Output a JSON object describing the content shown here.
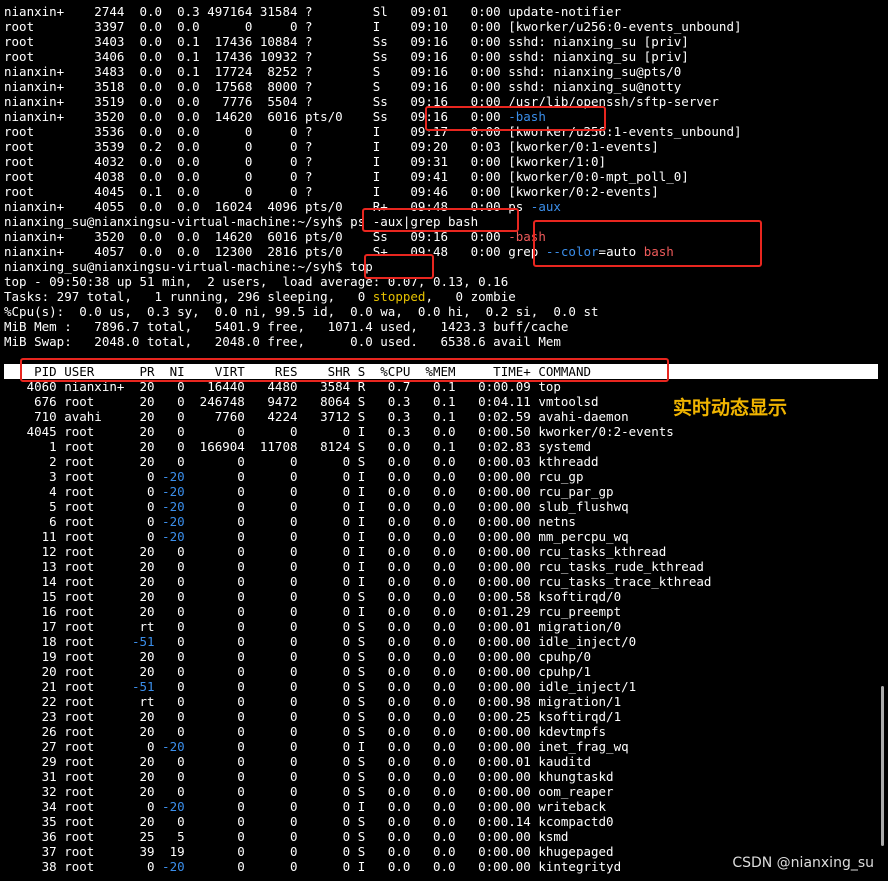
{
  "terminal": {
    "lines": [
      [
        {
          "t": "nianxin+    2744  0.0  0.3 497164 31584 ?        Sl   09:01   0:00 update-notifier"
        }
      ],
      [
        {
          "t": "root        3397  0.0  0.0      0     0 ?        I    09:10   0:00 [kworker/u256:0-events_unbound]"
        }
      ],
      [
        {
          "t": "root        3403  0.0  0.1  17436 10884 ?        Ss   09:16   0:00 sshd: nianxing_su [priv]"
        }
      ],
      [
        {
          "t": "root        3406  0.0  0.1  17436 10932 ?        Ss   09:16   0:00 sshd: nianxing_su [priv]"
        }
      ],
      [
        {
          "t": "nianxin+    3483  0.0  0.1  17724  8252 ?        S    09:16   0:00 sshd: nianxing_su@pts/0"
        }
      ],
      [
        {
          "t": "nianxin+    3518  0.0  0.0  17568  8000 ?        S    09:16   0:00 sshd: nianxing_su@notty"
        }
      ],
      [
        {
          "t": "nianxin+    3519  0.0  0.0   7776  5504 ?        Ss   09:16   0:00 /usr/lib/openssh/sftp-server"
        }
      ],
      [
        {
          "t": "nianxin+    3520  0.0  0.0  14620  6016 pts/0    Ss   09:16   0:00 "
        },
        {
          "t": "-bash",
          "c": "blue"
        }
      ],
      [
        {
          "t": "root        3536  0.0  0.0      0     0 ?        I    09:17   0:00 [kworker/u256:1-events_unbound]"
        }
      ],
      [
        {
          "t": "root        3539  0.2  0.0      0     0 ?        I    09:20   0:03 [kworker/0:1-events]"
        }
      ],
      [
        {
          "t": "root        4032  0.0  0.0      0     0 ?        I    09:31   0:00 [kworker/1:0]"
        }
      ],
      [
        {
          "t": "root        4038  0.0  0.0      0     0 ?        I    09:41   0:00 [kworker/0:0-mpt_poll_0]"
        }
      ],
      [
        {
          "t": "root        4045  0.1  0.0      0     0 ?        I    09:46   0:00 [kworker/0:2-events]"
        }
      ],
      [
        {
          "t": "nianxin+    4055  0.0  0.0  16024  4096 pts/0    R+   09:48   0:00 ps "
        },
        {
          "t": "-aux",
          "c": "blue"
        }
      ],
      [
        {
          "t": "nianxing_su@nianxingsu-virtual-machine:~/syh$ ps -aux|grep bash",
          "c": "prompt"
        }
      ],
      [
        {
          "t": "nianxin+    3520  0.0  0.0  14620  6016 pts/0    Ss   09:16   0:00 "
        },
        {
          "t": "-bash",
          "c": "red"
        }
      ],
      [
        {
          "t": "nianxin+    4057  0.0  0.0  12300  2816 pts/0    S+   09:48   0:00 grep "
        },
        {
          "t": "--color",
          "c": "blue"
        },
        {
          "t": "=auto "
        },
        {
          "t": "bash",
          "c": "red"
        }
      ],
      [
        {
          "t": "nianxing_su@nianxingsu-virtual-machine:~/syh$ top",
          "c": "prompt"
        }
      ],
      [
        {
          "t": "top - 09:50:38 up 51 min,  2 users,  load average: 0.07, 0.13, 0.16"
        }
      ],
      [
        {
          "t": "Tasks: 297 total,   1 running, 296 sleeping,   0 "
        },
        {
          "t": "stopped",
          "c": "yellow"
        },
        {
          "t": ",   0 zombie"
        }
      ],
      [
        {
          "t": "%Cpu(s):  0.0 us,  0.3 sy,  0.0 ni, 99.5 id,  0.0 wa,  0.0 hi,  0.2 si,  0.0 st"
        }
      ],
      [
        {
          "t": "MiB Mem :   7896.7 total,   5401.9 free,   1071.4 used,   1423.3 buff/cache"
        }
      ],
      [
        {
          "t": "MiB Swap:   2048.0 total,   2048.0 free,      0.0 used.   6538.6 avail Mem"
        }
      ],
      [
        {
          "t": ""
        }
      ],
      [
        {
          "t": "    PID USER      PR  NI    VIRT    RES    SHR S  %CPU  %MEM     TIME+ COMMAND",
          "header": true
        }
      ],
      [
        {
          "t": "   4060 nianxin+  20   0   16440   4480   3584 R   0.7   0.1   0:00.09 top"
        }
      ],
      [
        {
          "t": "    676 root      20   0  246748   9472   8064 S   0.3   0.1   0:04.11 vmtoolsd"
        }
      ],
      [
        {
          "t": "    710 avahi     20   0    7760   4224   3712 S   0.3   0.1   0:02.59 avahi-daemon"
        }
      ],
      [
        {
          "t": "   4045 root      20   0       0      0      0 I   0.3   0.0   0:00.50 kworker/0:2-events"
        }
      ],
      [
        {
          "t": "      1 root      20   0  166904  11708   8124 S   0.0   0.1   0:02.83 systemd"
        }
      ],
      [
        {
          "t": "      2 root      20   0       0      0      0 S   0.0   0.0   0:00.03 kthreadd"
        }
      ],
      [
        {
          "t": "      3 root       0 "
        },
        {
          "t": "-20",
          "c": "blue"
        },
        {
          "t": "       0      0      0 I   0.0   0.0   0:00.00 rcu_gp"
        }
      ],
      [
        {
          "t": "      4 root       0 "
        },
        {
          "t": "-20",
          "c": "blue"
        },
        {
          "t": "       0      0      0 I   0.0   0.0   0:00.00 rcu_par_gp"
        }
      ],
      [
        {
          "t": "      5 root       0 "
        },
        {
          "t": "-20",
          "c": "blue"
        },
        {
          "t": "       0      0      0 I   0.0   0.0   0:00.00 slub_flushwq"
        }
      ],
      [
        {
          "t": "      6 root       0 "
        },
        {
          "t": "-20",
          "c": "blue"
        },
        {
          "t": "       0      0      0 I   0.0   0.0   0:00.00 netns"
        }
      ],
      [
        {
          "t": "     11 root       0 "
        },
        {
          "t": "-20",
          "c": "blue"
        },
        {
          "t": "       0      0      0 I   0.0   0.0   0:00.00 mm_percpu_wq"
        }
      ],
      [
        {
          "t": "     12 root      20   0       0      0      0 I   0.0   0.0   0:00.00 rcu_tasks_kthread"
        }
      ],
      [
        {
          "t": "     13 root      20   0       0      0      0 I   0.0   0.0   0:00.00 rcu_tasks_rude_kthread"
        }
      ],
      [
        {
          "t": "     14 root      20   0       0      0      0 I   0.0   0.0   0:00.00 rcu_tasks_trace_kthread"
        }
      ],
      [
        {
          "t": "     15 root      20   0       0      0      0 S   0.0   0.0   0:00.58 ksoftirqd/0"
        }
      ],
      [
        {
          "t": "     16 root      20   0       0      0      0 I   0.0   0.0   0:01.29 rcu_preempt"
        }
      ],
      [
        {
          "t": "     17 root      rt   0       0      0      0 S   0.0   0.0   0:00.01 migration/0"
        }
      ],
      [
        {
          "t": "     18 root     "
        },
        {
          "t": "-51",
          "c": "blue"
        },
        {
          "t": "   0       0      0      0 S   0.0   0.0   0:00.00 idle_inject/0"
        }
      ],
      [
        {
          "t": "     19 root      20   0       0      0      0 S   0.0   0.0   0:00.00 cpuhp/0"
        }
      ],
      [
        {
          "t": "     20 root      20   0       0      0      0 S   0.0   0.0   0:00.00 cpuhp/1"
        }
      ],
      [
        {
          "t": "     21 root     "
        },
        {
          "t": "-51",
          "c": "blue"
        },
        {
          "t": "   0       0      0      0 S   0.0   0.0   0:00.00 idle_inject/1"
        }
      ],
      [
        {
          "t": "     22 root      rt   0       0      0      0 S   0.0   0.0   0:00.98 migration/1"
        }
      ],
      [
        {
          "t": "     23 root      20   0       0      0      0 S   0.0   0.0   0:00.25 ksoftirqd/1"
        }
      ],
      [
        {
          "t": "     26 root      20   0       0      0      0 S   0.0   0.0   0:00.00 kdevtmpfs"
        }
      ],
      [
        {
          "t": "     27 root       0 "
        },
        {
          "t": "-20",
          "c": "blue"
        },
        {
          "t": "       0      0      0 I   0.0   0.0   0:00.00 inet_frag_wq"
        }
      ],
      [
        {
          "t": "     29 root      20   0       0      0      0 S   0.0   0.0   0:00.01 kauditd"
        }
      ],
      [
        {
          "t": "     31 root      20   0       0      0      0 S   0.0   0.0   0:00.00 khungtaskd"
        }
      ],
      [
        {
          "t": "     32 root      20   0       0      0      0 S   0.0   0.0   0:00.00 oom_reaper"
        }
      ],
      [
        {
          "t": "     34 root       0 "
        },
        {
          "t": "-20",
          "c": "blue"
        },
        {
          "t": "       0      0      0 I   0.0   0.0   0:00.00 writeback"
        }
      ],
      [
        {
          "t": "     35 root      20   0       0      0      0 S   0.0   0.0   0:00.14 kcompactd0"
        }
      ],
      [
        {
          "t": "     36 root      25   5       0      0      0 S   0.0   0.0   0:00.00 ksmd"
        }
      ],
      [
        {
          "t": "     37 root      39  19       0      0      0 S   0.0   0.0   0:00.00 khugepaged"
        }
      ],
      [
        {
          "t": "     38 root       0 "
        },
        {
          "t": "-20",
          "c": "blue"
        },
        {
          "t": "       0      0      0 I   0.0   0.0   0:00.00 kintegrityd"
        }
      ]
    ]
  },
  "annotation": {
    "label": "实时动态显示"
  },
  "watermark": "CSDN @nianxing_su",
  "colors": {
    "background": "#000000",
    "text": "#ffffff",
    "highlight_blue": "#3b8eea",
    "match_red": "#ef5b5b",
    "stopped_yellow": "#e5c100",
    "annotation_red": "#e8261f",
    "annotation_text": "#f0b400"
  }
}
